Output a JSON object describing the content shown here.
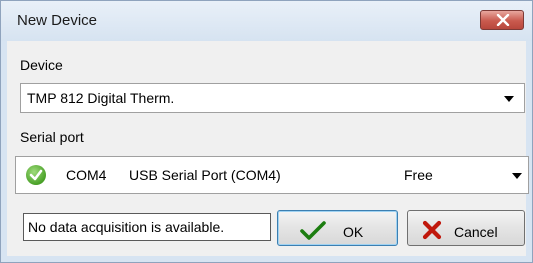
{
  "window": {
    "title": "New Device"
  },
  "device": {
    "label": "Device",
    "selected": "TMP 812 Digital Therm."
  },
  "serial_port": {
    "label": "Serial port",
    "port": "COM4",
    "description": "USB Serial Port (COM4)",
    "status": "Free"
  },
  "status_message": "No data acquisition is available.",
  "buttons": {
    "ok": "OK",
    "cancel": "Cancel"
  },
  "icons": {
    "close": "close-icon",
    "port_status": "check-circle-icon",
    "ok": "checkmark-icon",
    "cancel": "x-icon"
  },
  "colors": {
    "ok_check": "#1c7d10",
    "cancel_x": "#c0180c",
    "close_button": "#c95a4e"
  }
}
